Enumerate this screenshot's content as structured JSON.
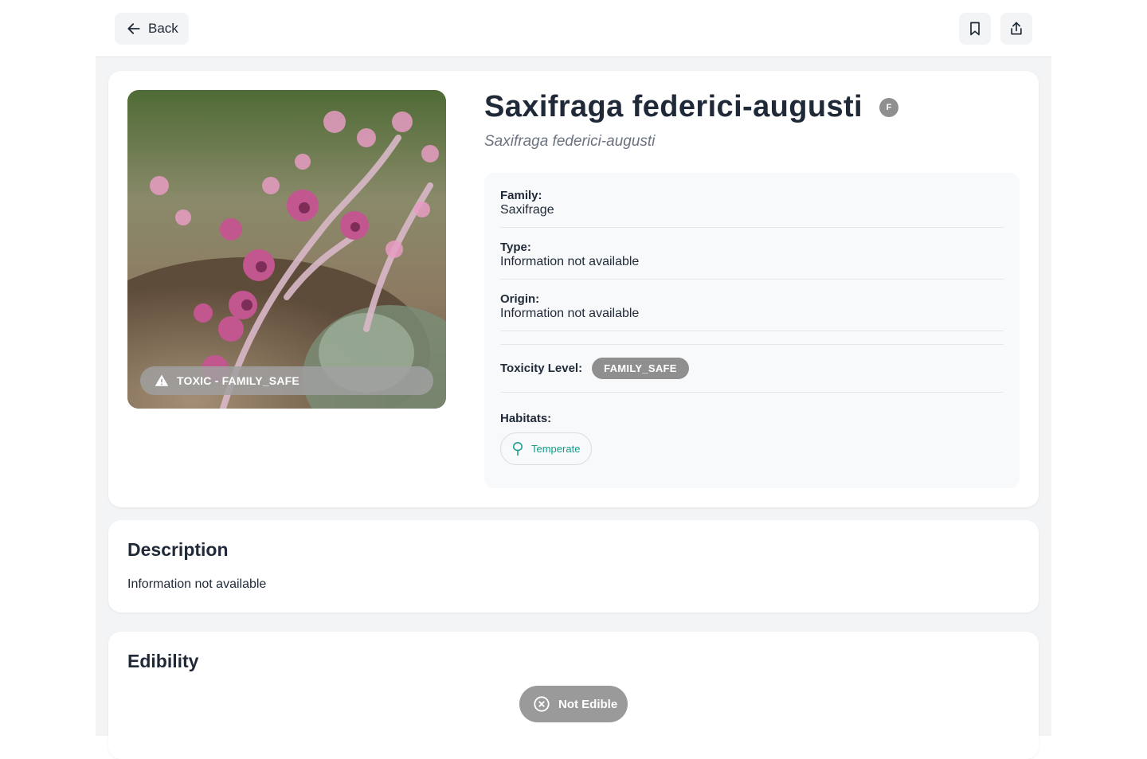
{
  "header": {
    "back_label": "Back",
    "bookmark_icon": "bookmark-icon",
    "share_icon": "share-icon"
  },
  "plant": {
    "common_name": "Saxifraga federici-augusti",
    "badge": "F",
    "scientific_name": "Saxifraga federici-augusti",
    "toxic_banner": "TOXIC - FAMILY_SAFE",
    "family_label": "Family:",
    "family_value": "Saxifrage",
    "type_label": "Type:",
    "type_value": "Information not available",
    "origin_label": "Origin:",
    "origin_value": "Information not available",
    "toxicity_label": "Toxicity Level:",
    "toxicity_value": "FAMILY_SAFE",
    "habitats_label": "Habitats:",
    "habitats": [
      {
        "label": "Temperate",
        "icon": "tree-icon"
      }
    ]
  },
  "description": {
    "title": "Description",
    "text": "Information not available"
  },
  "edibility": {
    "title": "Edibility",
    "status": "Not Edible"
  },
  "colors": {
    "accent_teal": "#139c8a",
    "badge_gray": "#8f8f8f",
    "background": "#f3f4f6"
  }
}
